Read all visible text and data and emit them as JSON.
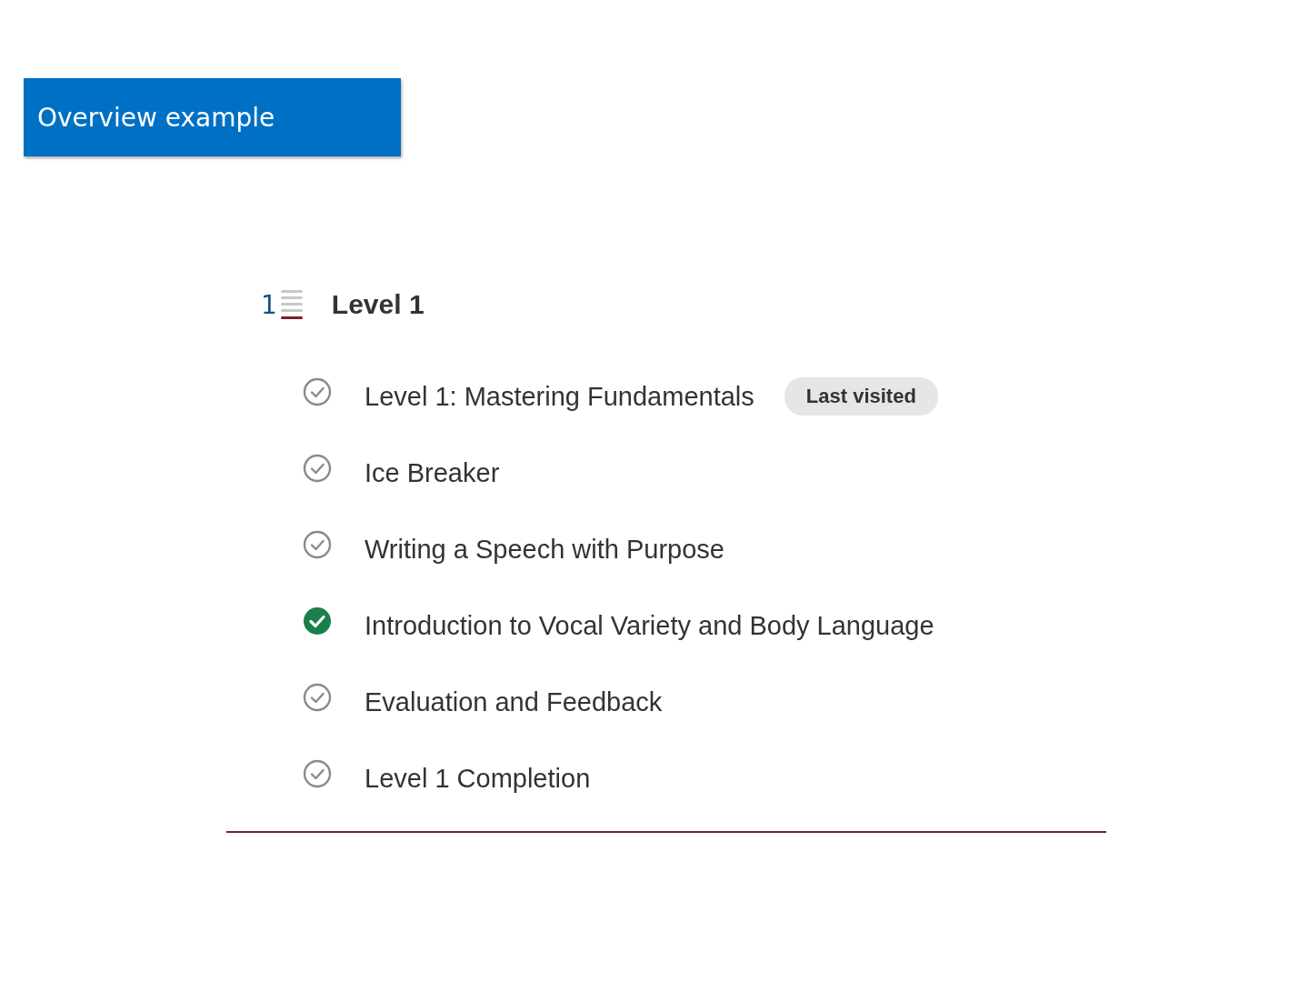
{
  "banner": {
    "title": "Overview example"
  },
  "section": {
    "icon_number": "1",
    "title": "Level 1"
  },
  "items": [
    {
      "label": "Level 1: Mastering Fundamentals",
      "completed": false,
      "badge": "Last visited"
    },
    {
      "label": "Ice Breaker",
      "completed": false
    },
    {
      "label": "Writing a Speech with Purpose",
      "completed": false
    },
    {
      "label": "Introduction to Vocal Variety and Body Language",
      "completed": true
    },
    {
      "label": "Evaluation and Feedback",
      "completed": false
    },
    {
      "label": "Level 1 Completion",
      "completed": false
    }
  ]
}
